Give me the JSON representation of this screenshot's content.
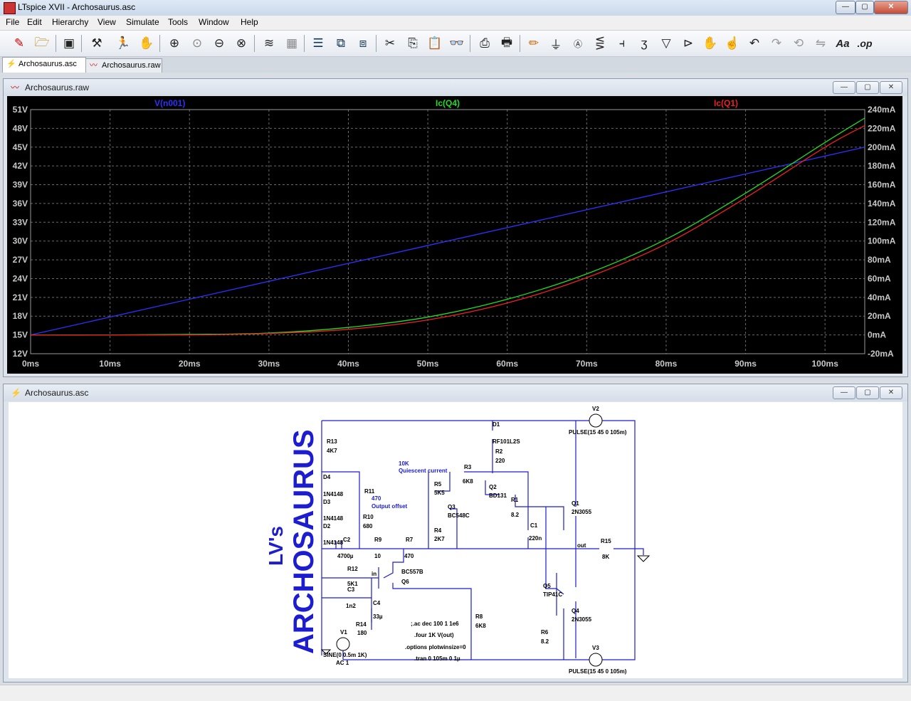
{
  "window": {
    "title": "LTspice XVII - Archosaurus.asc",
    "buttons": {
      "minimize": "—",
      "maximize": "▢",
      "close": "✕"
    }
  },
  "menu": [
    "File",
    "Edit",
    "Hierarchy",
    "View",
    "Simulate",
    "Tools",
    "Window",
    "Help"
  ],
  "toolbar": {
    "icons": [
      "new-schematic-icon",
      "open-icon",
      "save-icon",
      "control-panel-icon",
      "run-icon",
      "halt-icon",
      "zoom-in-icon",
      "zoom-fit-icon",
      "zoom-out-icon",
      "zoom-cancel-icon",
      "autorange-icon",
      "grid-icon",
      "tile-horizontal-icon",
      "cascade-icon",
      "tile-vertical-icon",
      "cut-icon",
      "copy-icon",
      "paste-icon",
      "find-icon",
      "print-icon",
      "print-setup-icon",
      "draw-wire-icon",
      "ground-icon",
      "label-net-icon",
      "resistor-icon",
      "capacitor-icon",
      "inductor-icon",
      "diode-icon",
      "component-icon",
      "move-icon",
      "drag-icon",
      "undo-icon",
      "redo-icon",
      "rotate-icon",
      "mirror-icon",
      "text-icon",
      "spice-directive-icon"
    ],
    "text_buttons": {
      "text": "Aa",
      "directive": ".op"
    }
  },
  "tabs": [
    {
      "label": "Archosaurus.asc",
      "active": true,
      "icon": "schematic-icon"
    },
    {
      "label": "Archosaurus.raw",
      "active": false,
      "icon": "waveform-icon"
    }
  ],
  "waveform_window": {
    "title": "Archosaurus.raw"
  },
  "schematic_window": {
    "title": "Archosaurus.asc"
  },
  "chart_data": {
    "type": "line",
    "background": "#000000",
    "grid": true,
    "x": {
      "label_ticks": [
        "0ms",
        "10ms",
        "20ms",
        "30ms",
        "40ms",
        "50ms",
        "60ms",
        "70ms",
        "80ms",
        "90ms",
        "100ms"
      ],
      "range": [
        0,
        105
      ]
    },
    "y_left": {
      "ticks": [
        "51V",
        "48V",
        "45V",
        "42V",
        "39V",
        "36V",
        "33V",
        "30V",
        "27V",
        "24V",
        "21V",
        "18V",
        "15V",
        "12V"
      ],
      "range": [
        12,
        51
      ]
    },
    "y_right": {
      "ticks": [
        "240mA",
        "220mA",
        "200mA",
        "180mA",
        "160mA",
        "140mA",
        "120mA",
        "100mA",
        "80mA",
        "60mA",
        "40mA",
        "20mA",
        "0mA",
        "-20mA"
      ],
      "range": [
        -20,
        240
      ]
    },
    "series": [
      {
        "name": "V(n001)",
        "color": "#3030ff",
        "axis": "left",
        "x": [
          0,
          105
        ],
        "values": [
          15,
          45
        ]
      },
      {
        "name": "Ic(Q4)",
        "color": "#22dd22",
        "axis": "right",
        "x": [
          0,
          10,
          20,
          30,
          40,
          50,
          60,
          70,
          80,
          90,
          100,
          105
        ],
        "values": [
          0,
          0,
          0.5,
          2,
          8,
          19,
          38,
          65,
          102,
          151,
          205,
          231
        ]
      },
      {
        "name": "Ic(Q1)",
        "color": "#ee2222",
        "axis": "right",
        "x": [
          0,
          10,
          20,
          30,
          40,
          50,
          60,
          70,
          80,
          90,
          100,
          105
        ],
        "values": [
          0,
          0,
          0,
          1.5,
          6,
          16,
          34,
          61,
          97,
          146,
          200,
          223
        ]
      }
    ]
  },
  "schematic": {
    "brand_title": "ARCHOSAURUS",
    "brand_subtitle": "LV's",
    "directives": [
      ";.ac dec 100 1 1e6",
      ".four 1K V(out)",
      ".options plotwinsize=0",
      ".tran 0 105m 0 1µ"
    ],
    "components": {
      "R13": [
        "R13",
        "4K7"
      ],
      "D4": [
        "D4",
        "1N4148"
      ],
      "D3": [
        "D3",
        "1N4148"
      ],
      "D2": [
        "D2",
        "1N4148"
      ],
      "R11": [
        "R11",
        "470",
        "Output offset"
      ],
      "R10": [
        "R10",
        "680"
      ],
      "C2": [
        "C2",
        "4700µ"
      ],
      "R9": [
        "R9",
        "10"
      ],
      "R7": [
        "R7",
        "470"
      ],
      "R12": [
        "R12",
        "5K1"
      ],
      "C3": [
        "C3",
        "1n2"
      ],
      "C4": [
        "C4",
        "33µ"
      ],
      "R14": [
        "R14",
        "180"
      ],
      "V1": [
        "V1",
        "SINE(0 0.5m 1K)",
        "AC 1"
      ],
      "Q6": [
        "Q6",
        "BC557B"
      ],
      "R5": [
        "R5",
        "5K5",
        "10K",
        "Quiescent current"
      ],
      "Q3": [
        "Q3",
        "BC548C"
      ],
      "R4": [
        "R4",
        "2K7"
      ],
      "R3": [
        "R3",
        "6K8"
      ],
      "Q2": [
        "Q2",
        "BD131"
      ],
      "D1": [
        "D1",
        "RF101L2S"
      ],
      "R2": [
        "R2",
        "220"
      ],
      "R1": [
        "R1",
        "8.2"
      ],
      "C1": [
        "C1",
        "220n"
      ],
      "Q1": [
        "Q1",
        "2N3055"
      ],
      "V2": [
        "V2",
        "PULSE(15 45 0 105m)"
      ],
      "R15": [
        "R15",
        "8K"
      ],
      "Q5": [
        "Q5",
        "TIP41C"
      ],
      "Q4": [
        "Q4",
        "2N3055"
      ],
      "R6": [
        "R6",
        "8.2"
      ],
      "R8": [
        "R8",
        "6K8"
      ],
      "V3": [
        "V3",
        "PULSE(15 45 0 105m)"
      ]
    },
    "nets": {
      "out": "out",
      "in": "in"
    }
  }
}
